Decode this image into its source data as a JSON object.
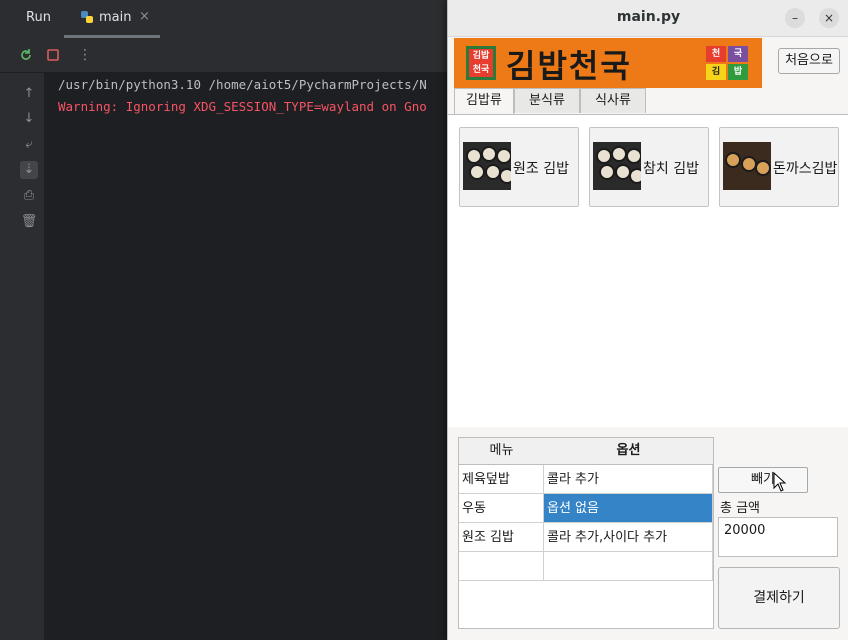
{
  "ide": {
    "run_label": "Run",
    "tab_label": "main",
    "tab_close": "×",
    "console_lines": [
      "/usr/bin/python3.10 /home/aiot5/PycharmProjects/N",
      "Warning: Ignoring XDG_SESSION_TYPE=wayland on Gno"
    ]
  },
  "window": {
    "title": "main.py",
    "minimize": "–",
    "close": "×"
  },
  "logo": {
    "text": "김밥천국",
    "left_badge": "김밥천국",
    "right_badges": [
      "천",
      "국",
      "김",
      "밥"
    ]
  },
  "home_button": "처음으로",
  "tabs": [
    {
      "label": "김밥류",
      "active": true
    },
    {
      "label": "분식류",
      "active": false
    },
    {
      "label": "식사류",
      "active": false
    }
  ],
  "menu_items": [
    {
      "label": "원조 김밥"
    },
    {
      "label": "참치 김밥"
    },
    {
      "label": "돈까스김밥"
    }
  ],
  "order_table": {
    "headers": [
      "메뉴",
      "옵션"
    ],
    "rows": [
      {
        "menu": "제육덮밥",
        "option": "콜라 추가",
        "selected": false
      },
      {
        "menu": "우동",
        "option": "옵션 없음",
        "selected": true
      },
      {
        "menu": "원조 김밥",
        "option": "콜라 추가,사이다 추가",
        "selected": false
      },
      {
        "menu": "",
        "option": "",
        "selected": false
      }
    ]
  },
  "minus_button": "빼기",
  "total": {
    "label": "총 금액",
    "value": "20000"
  },
  "pay_button": "결제하기",
  "colors": {
    "ide_bg": "#1e1f22",
    "console_error": "#f75464",
    "logo_bg": "#ee7a17",
    "selection": "#3584c8"
  }
}
